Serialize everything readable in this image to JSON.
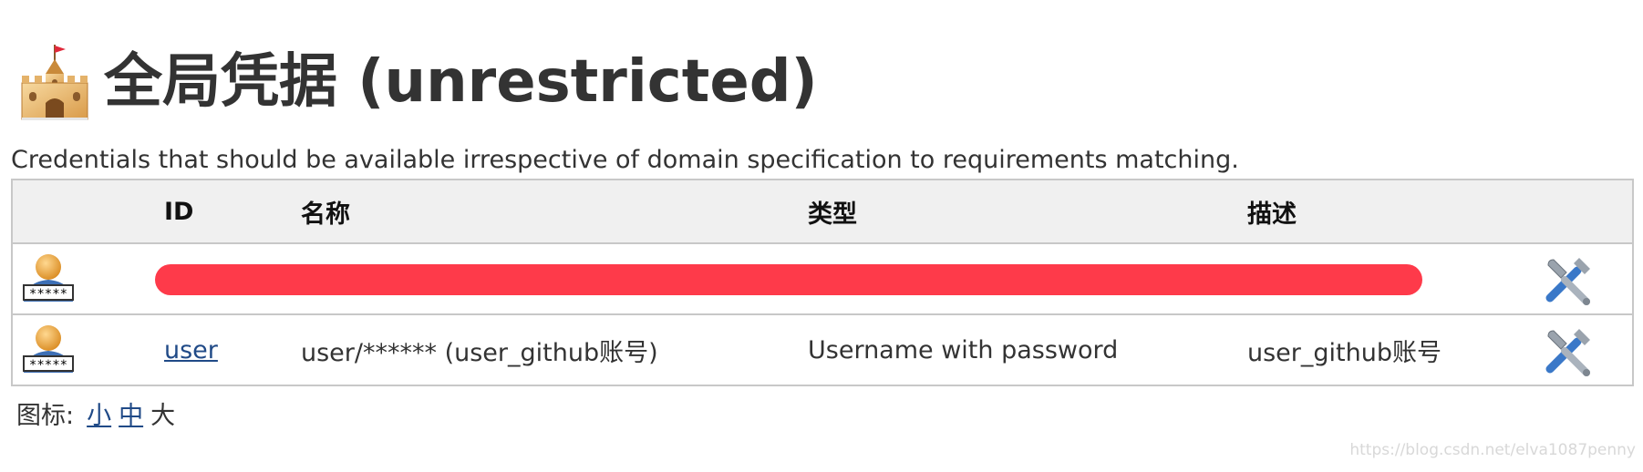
{
  "header": {
    "title": "全局凭据 (unrestricted)",
    "icon": "castle-icon"
  },
  "description": "Credentials that should be available irrespective of domain specification to requirements matching.",
  "table": {
    "columns": [
      "",
      "ID",
      "名称",
      "类型",
      "描述",
      ""
    ],
    "rows": [
      {
        "icon": "user-password-icon",
        "redacted": true,
        "action_icon": "wrench-screwdriver-icon"
      },
      {
        "icon": "user-password-icon",
        "id": "user",
        "name": "user/****** (user_github账号)",
        "type": "Username with password",
        "description": "user_github账号",
        "action_icon": "wrench-screwdriver-icon"
      }
    ]
  },
  "icon_size": {
    "label": "图标:",
    "options": [
      "小",
      "中",
      "大"
    ],
    "selected": "大"
  },
  "watermark": "https://blog.csdn.net/elva1087penny",
  "colors": {
    "redaction": "#fe3a4a",
    "link": "#204a87",
    "header_bg": "#f0f0f0",
    "border": "#c8c8c8"
  }
}
